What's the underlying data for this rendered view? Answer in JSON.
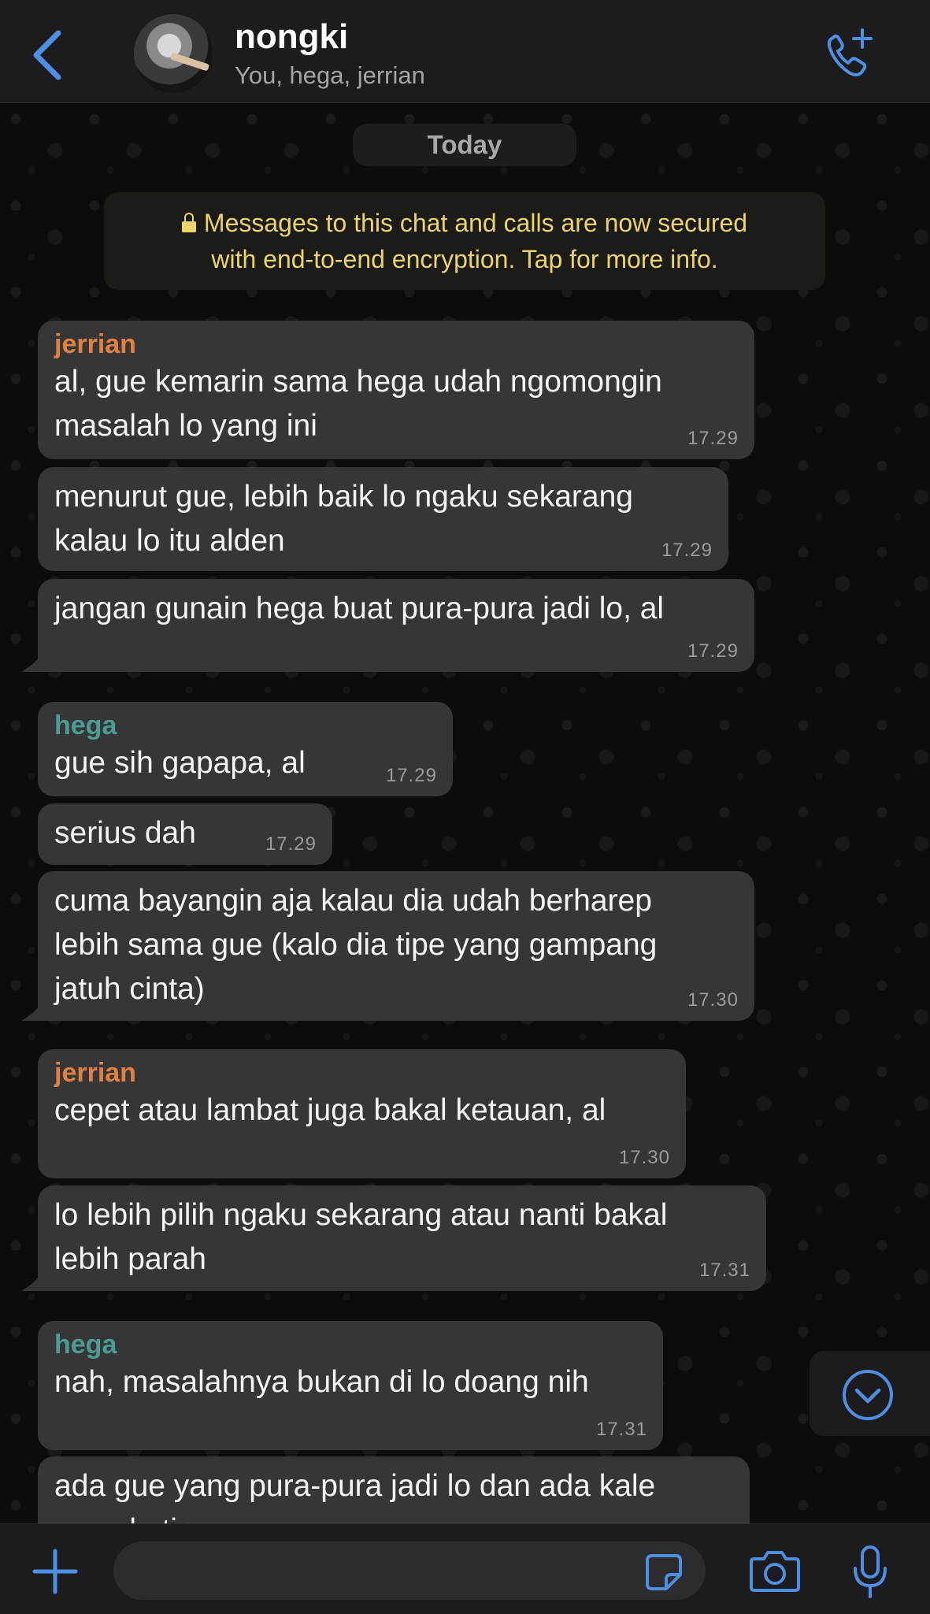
{
  "header": {
    "title": "nongki",
    "subtitle": "You, hega, jerrian"
  },
  "chat": {
    "date_label": "Today",
    "encryption_line1": "Messages to this chat and calls are now secured",
    "encryption_line2": "with end-to-end encryption. Tap for more info.",
    "messages": [
      {
        "sender": "jerrian",
        "lines": [
          "al, gue kemarin sama hega udah ngomongin",
          "masalah lo yang ini"
        ],
        "time": "17.29"
      },
      {
        "sender": "",
        "lines": [
          "menurut gue, lebih baik lo ngaku sekarang",
          "kalau lo itu alden"
        ],
        "time": "17.29"
      },
      {
        "sender": "",
        "lines": [
          "jangan gunain hega buat pura-pura jadi lo, al"
        ],
        "time": "17.29"
      },
      {
        "sender": "hega",
        "lines": [
          "gue sih gapapa, al"
        ],
        "time": "17.29"
      },
      {
        "sender": "",
        "lines": [
          "serius dah"
        ],
        "time": "17.29"
      },
      {
        "sender": "",
        "lines": [
          "cuma bayangin aja kalau dia udah berharep",
          "lebih sama gue (kalo dia tipe yang gampang",
          "jatuh cinta)"
        ],
        "time": "17.30"
      },
      {
        "sender": "jerrian",
        "lines": [
          "cepet atau lambat juga bakal ketauan, al"
        ],
        "time": "17.30"
      },
      {
        "sender": "",
        "lines": [
          "lo lebih pilih ngaku sekarang atau nanti bakal",
          "lebih parah"
        ],
        "time": "17.31"
      },
      {
        "sender": "hega",
        "lines": [
          "nah, masalahnya bukan di lo doang nih"
        ],
        "time": "17.31"
      },
      {
        "sender": "",
        "lines": [
          "ada gue yang pura-pura jadi lo dan ada kale",
          "yang lo tipu"
        ],
        "time": ""
      }
    ]
  },
  "colors": {
    "sender_jerrian": "#e1813f",
    "sender_hega": "#4c9c93",
    "encryption_text": "#ecd36b",
    "accent": "#4d8fe3"
  },
  "icons": {
    "back": "chevron-left-icon",
    "call": "phone-plus-icon",
    "scroll": "chevron-down-circle-icon",
    "composer": [
      "plus-icon",
      "sticker-icon",
      "camera-icon",
      "microphone-icon"
    ]
  }
}
